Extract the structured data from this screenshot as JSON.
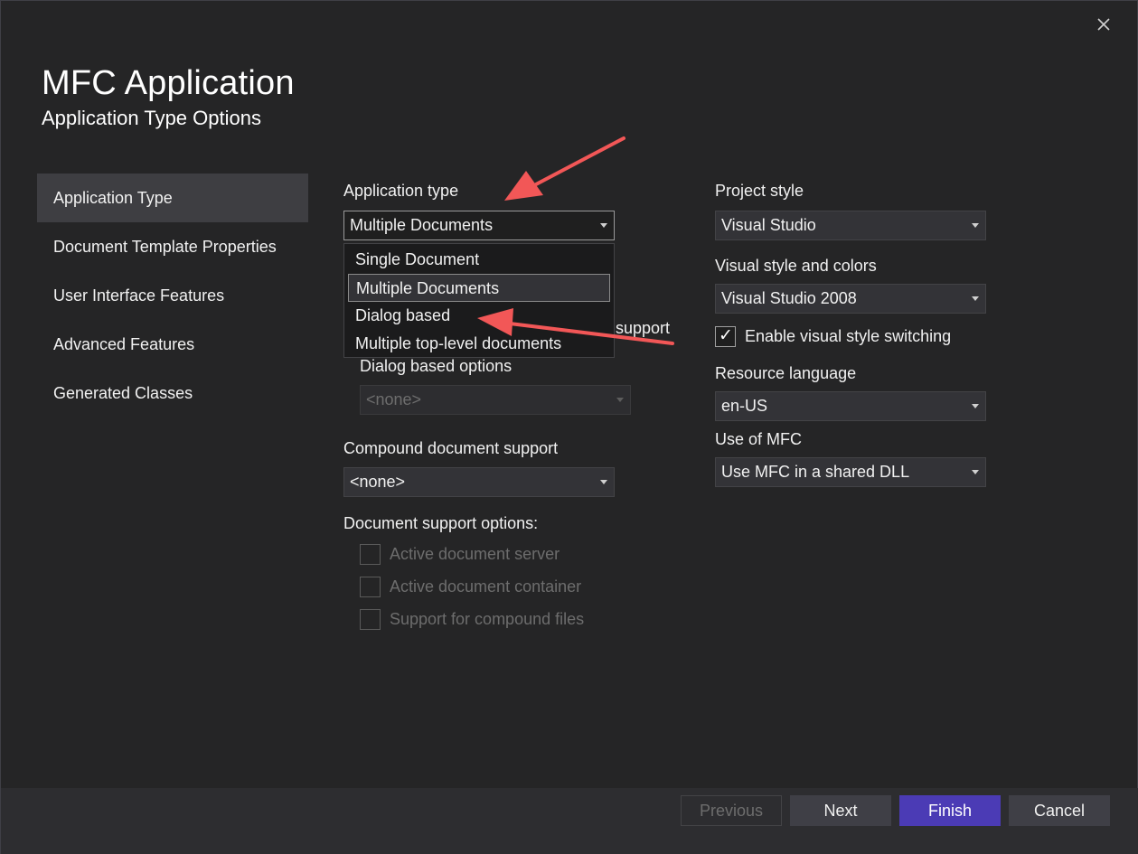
{
  "window": {
    "title": "MFC Application",
    "subtitle": "Application Type Options"
  },
  "nav": {
    "items": [
      {
        "label": "Application Type",
        "active": true
      },
      {
        "label": "Document Template Properties"
      },
      {
        "label": "User Interface Features"
      },
      {
        "label": "Advanced Features"
      },
      {
        "label": "Generated Classes"
      }
    ]
  },
  "app_type": {
    "label": "Application type",
    "selected": "Multiple Documents",
    "options": [
      "Single Document",
      "Multiple Documents",
      "Dialog based",
      "Multiple top-level documents"
    ],
    "hidden_label_tail": "support"
  },
  "dialog_options": {
    "label": "Dialog based options",
    "value": "<none>"
  },
  "compound": {
    "label": "Compound document support",
    "value": "<none>"
  },
  "doc_support": {
    "label": "Document support options:",
    "options": [
      {
        "label": "Active document server",
        "checked": false
      },
      {
        "label": "Active document container",
        "checked": false
      },
      {
        "label": "Support for compound files",
        "checked": false
      }
    ]
  },
  "project_style": {
    "label": "Project style",
    "value": "Visual Studio"
  },
  "visual_style": {
    "label": "Visual style and colors",
    "value": "Visual Studio 2008"
  },
  "style_switching": {
    "label": "Enable visual style switching",
    "checked": true
  },
  "resource_language": {
    "label": "Resource language",
    "value": "en-US"
  },
  "use_mfc": {
    "label": "Use of MFC",
    "value": "Use MFC in a shared DLL"
  },
  "footer": {
    "previous": "Previous",
    "next": "Next",
    "finish": "Finish",
    "cancel": "Cancel"
  },
  "colors": {
    "background": "#252526",
    "accent": "#4b3bb5",
    "annotation": "#f25757"
  }
}
